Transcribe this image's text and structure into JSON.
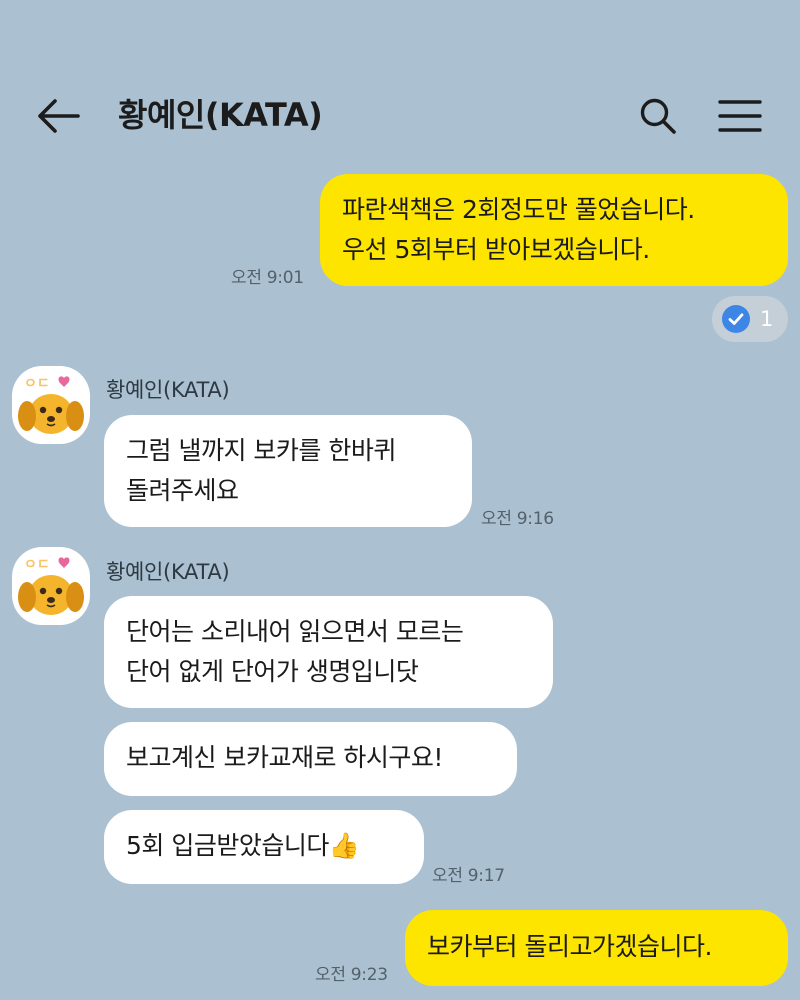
{
  "header": {
    "title": "황예인(KATA)",
    "back_icon": "arrow-left-icon",
    "search_icon": "search-icon",
    "menu_icon": "hamburger-menu-icon"
  },
  "messages": [
    {
      "direction": "out",
      "text": "파란색책은 2회정도만 풀었습니다.\n우선 5회부터 받아보겠습니다.",
      "time": "오전 9:01",
      "read_count": "1"
    },
    {
      "direction": "in",
      "sender": "황예인(KATA)",
      "text": "그럼 낼까지 보카를 한바퀴\n돌려주세요",
      "time": "오전 9:16"
    },
    {
      "direction": "in",
      "sender": "황예인(KATA)",
      "text": "단어는 소리내어 읽으면서 모르는\n단어 없게 단어가 생명입니닷"
    },
    {
      "direction": "in",
      "text": "보고계신 보카교재로 하시구요!"
    },
    {
      "direction": "in",
      "text": "5회 입금받았습니다👍",
      "time": "오전 9:17"
    },
    {
      "direction": "out",
      "text": "보카부터 돌리고가겠습니다.",
      "time": "오전 9:23"
    }
  ],
  "colors": {
    "background": "#abc1d1",
    "outgoing_bubble": "#fee500",
    "incoming_bubble": "#ffffff",
    "read_check": "#3d86e6"
  }
}
